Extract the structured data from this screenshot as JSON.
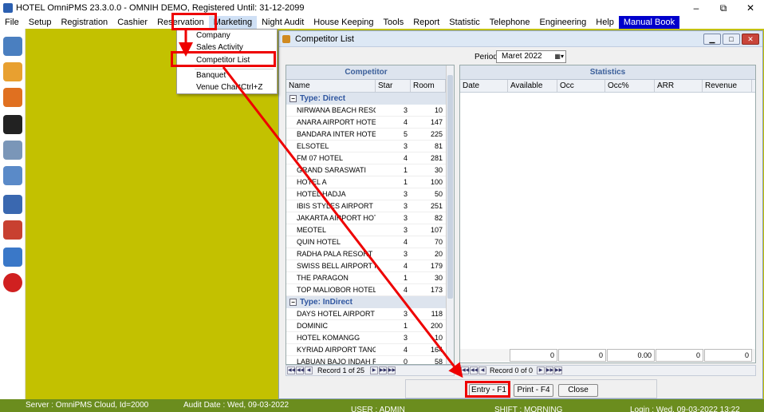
{
  "titlebar": {
    "title": "HOTEL OmniPMS 23.3.0.0 - OMNIH DEMO, Registered Until: 31-12-2099",
    "minimize": "–",
    "maximize": "⧉",
    "close": "✕"
  },
  "menu": [
    "File",
    "Setup",
    "Registration",
    "Cashier",
    "Reservation",
    "Marketing",
    "Night Audit",
    "House Keeping",
    "Tools",
    "Report",
    "Statistic",
    "Telephone",
    "Engineering",
    "Help",
    "Manual Book"
  ],
  "dropdown": {
    "items": [
      {
        "label": "Company"
      },
      {
        "label": "Sales Activity"
      },
      {
        "label": "Competitor List"
      },
      {
        "label": "Banquet"
      },
      {
        "label": "Venue Chart",
        "shortcut": "Ctrl+Z"
      }
    ]
  },
  "window": {
    "title": "Competitor List",
    "period_label": "Period",
    "period_value": "Maret   2022"
  },
  "competitor_grid": {
    "band": "Competitor",
    "columns": [
      "Name",
      "Star",
      "Room"
    ],
    "groups": [
      {
        "label": "Type: Direct",
        "rows": [
          [
            "NIRWANA BEACH RESORT",
            "3",
            "10"
          ],
          [
            "ANARA AIRPORT HOTEL",
            "4",
            "147"
          ],
          [
            "BANDARA INTER HOTEL",
            "5",
            "225"
          ],
          [
            "ELSOTEL",
            "3",
            "81"
          ],
          [
            "FM 07 HOTEL",
            "4",
            "281"
          ],
          [
            "GRAND SARASWATI",
            "1",
            "30"
          ],
          [
            "HOTEL A",
            "1",
            "100"
          ],
          [
            "HOTEL HADJA",
            "3",
            "50"
          ],
          [
            "IBIS STYLES AIRPORT HO...",
            "3",
            "251"
          ],
          [
            "JAKARTA AIRPORT HOTEL",
            "3",
            "82"
          ],
          [
            "MEOTEL",
            "3",
            "107"
          ],
          [
            "QUIN HOTEL",
            "4",
            "70"
          ],
          [
            "RADHA PALA RESORT",
            "3",
            "20"
          ],
          [
            "SWISS BELL AIRPORT HO...",
            "4",
            "179"
          ],
          [
            "THE PARAGON",
            "1",
            "30"
          ],
          [
            "TOP MALIOBOR HOTEL",
            "4",
            "173"
          ]
        ]
      },
      {
        "label": "Type: InDirect",
        "rows": [
          [
            "DAYS HOTEL AIRPORT",
            "3",
            "118"
          ],
          [
            "DOMINIC",
            "1",
            "200"
          ],
          [
            "HOTEL KOMANGG",
            "3",
            "10"
          ],
          [
            "KYRIAD AIRPORT TANGE...",
            "4",
            "164"
          ],
          [
            "LABUAN BAJO INDAH RE...",
            "0",
            "58"
          ]
        ]
      }
    ],
    "record": "Record 1 of 25"
  },
  "stats_grid": {
    "band": "Statistics",
    "columns": [
      "Date",
      "Available",
      "Occ",
      "Occ%",
      "ARR",
      "Revenue"
    ],
    "totals": [
      "0",
      "0",
      "0.00",
      "0",
      "0"
    ],
    "record": "Record 0 of 0"
  },
  "buttons": {
    "entry": "Entry - F1",
    "print": "Print - F4",
    "close": "Close"
  },
  "statusbar": {
    "server": "Server : OmniPMS Cloud, Id=2000",
    "audit": "Audit Date : Wed, 09-03-2022",
    "user": "USER : ADMIN",
    "shift": "SHIFT : MORNING",
    "login": "Login : Wed, 09-03-2022 13:22"
  },
  "colors": {
    "workspace": "#c3c100",
    "statusbar": "#6b8d1e",
    "highlight": "#ee0000"
  }
}
